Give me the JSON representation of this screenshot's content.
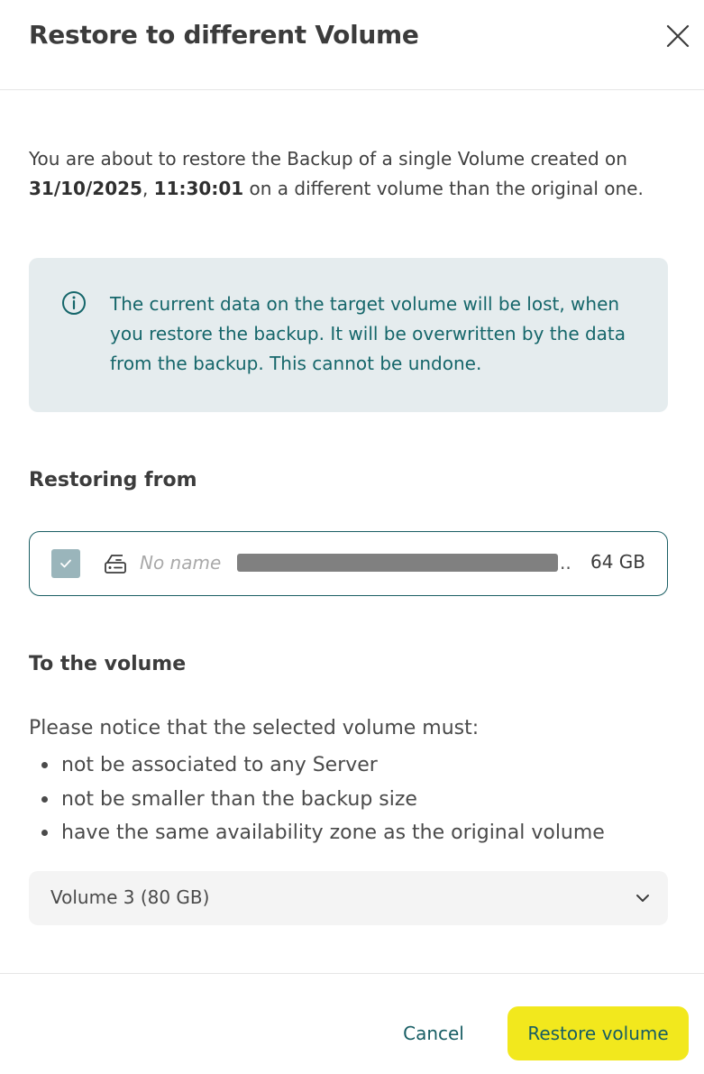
{
  "dialog": {
    "title": "Restore to different Volume",
    "close_icon": "close-icon"
  },
  "intro": {
    "text_before": "You are about to restore the Backup of a single Volume created on",
    "date": "31/10/2025",
    "separator": ", ",
    "time": "11:30:01",
    "text_after": " on a different volume than the original one."
  },
  "alert": {
    "icon": "info-icon",
    "text": "The current data on the target volume will be lost, when you restore the backup. It will be overwritten by the data from the backup. This cannot be undone."
  },
  "restoring_from": {
    "heading": "Restoring from",
    "item": {
      "checked": true,
      "icon": "disk-icon",
      "name": "No name",
      "ellipsis": "..",
      "size": "64 GB"
    }
  },
  "to_volume": {
    "heading": "To the volume",
    "notice": "Please notice that the selected volume must:",
    "requirements": [
      "not be associated to any Server",
      "not be smaller than the backup size",
      "have the same availability zone as the original volume"
    ],
    "select": {
      "value": "Volume 3 (80 GB)",
      "icon": "chevron-down-icon"
    }
  },
  "footer": {
    "cancel_label": "Cancel",
    "restore_label": "Restore volume"
  },
  "colors": {
    "accent": "#175d63",
    "primary_button": "#f2e81d",
    "alert_bg": "#e5ecee",
    "checkbox": "#9ab5bb"
  }
}
